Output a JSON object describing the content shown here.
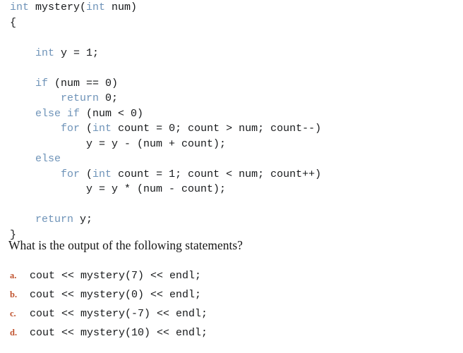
{
  "colors": {
    "background": "#ffffff",
    "code_text": "#16181a",
    "keyword": "#6e93b8",
    "option_label": "#c0522d",
    "prompt_text": "#161616"
  },
  "code": {
    "language": "C++",
    "lines": [
      {
        "indent": 0,
        "tokens": [
          {
            "t": "int",
            "k": true
          },
          {
            "t": " mystery(",
            "k": false
          },
          {
            "t": "int",
            "k": true
          },
          {
            "t": " num)",
            "k": false
          }
        ]
      },
      {
        "indent": 0,
        "tokens": [
          {
            "t": "{",
            "k": false
          }
        ]
      },
      {
        "indent": 0,
        "tokens": []
      },
      {
        "indent": 1,
        "tokens": [
          {
            "t": "int",
            "k": true
          },
          {
            "t": " y = 1;",
            "k": false
          }
        ]
      },
      {
        "indent": 0,
        "tokens": []
      },
      {
        "indent": 1,
        "tokens": [
          {
            "t": "if",
            "k": true
          },
          {
            "t": " (num == 0)",
            "k": false
          }
        ]
      },
      {
        "indent": 2,
        "tokens": [
          {
            "t": "return",
            "k": true
          },
          {
            "t": " 0;",
            "k": false
          }
        ]
      },
      {
        "indent": 1,
        "tokens": [
          {
            "t": "else if",
            "k": true
          },
          {
            "t": " (num < 0)",
            "k": false
          }
        ]
      },
      {
        "indent": 2,
        "tokens": [
          {
            "t": "for",
            "k": true
          },
          {
            "t": " (",
            "k": false
          },
          {
            "t": "int",
            "k": true
          },
          {
            "t": " count = 0; count > num; count--)",
            "k": false
          }
        ]
      },
      {
        "indent": 3,
        "tokens": [
          {
            "t": "y = y - (num + count);",
            "k": false
          }
        ]
      },
      {
        "indent": 1,
        "tokens": [
          {
            "t": "else",
            "k": true
          }
        ]
      },
      {
        "indent": 2,
        "tokens": [
          {
            "t": "for",
            "k": true
          },
          {
            "t": " (",
            "k": false
          },
          {
            "t": "int",
            "k": true
          },
          {
            "t": " count = 1; count < num; count++)",
            "k": false
          }
        ]
      },
      {
        "indent": 3,
        "tokens": [
          {
            "t": "y = y * (num - count);",
            "k": false
          }
        ]
      },
      {
        "indent": 0,
        "tokens": []
      },
      {
        "indent": 1,
        "tokens": [
          {
            "t": "return",
            "k": true
          },
          {
            "t": " y;",
            "k": false
          }
        ]
      },
      {
        "indent": 0,
        "tokens": [
          {
            "t": "}",
            "k": false
          }
        ]
      }
    ]
  },
  "prompt": {
    "text": "What is the output of the following statements?"
  },
  "options": [
    {
      "label": "a.",
      "code": "cout << mystery(7) << endl;"
    },
    {
      "label": "b.",
      "code": "cout << mystery(0) << endl;"
    },
    {
      "label": "c.",
      "code": "cout << mystery(-7) << endl;"
    },
    {
      "label": "d.",
      "code": "cout << mystery(10) << endl;"
    }
  ]
}
